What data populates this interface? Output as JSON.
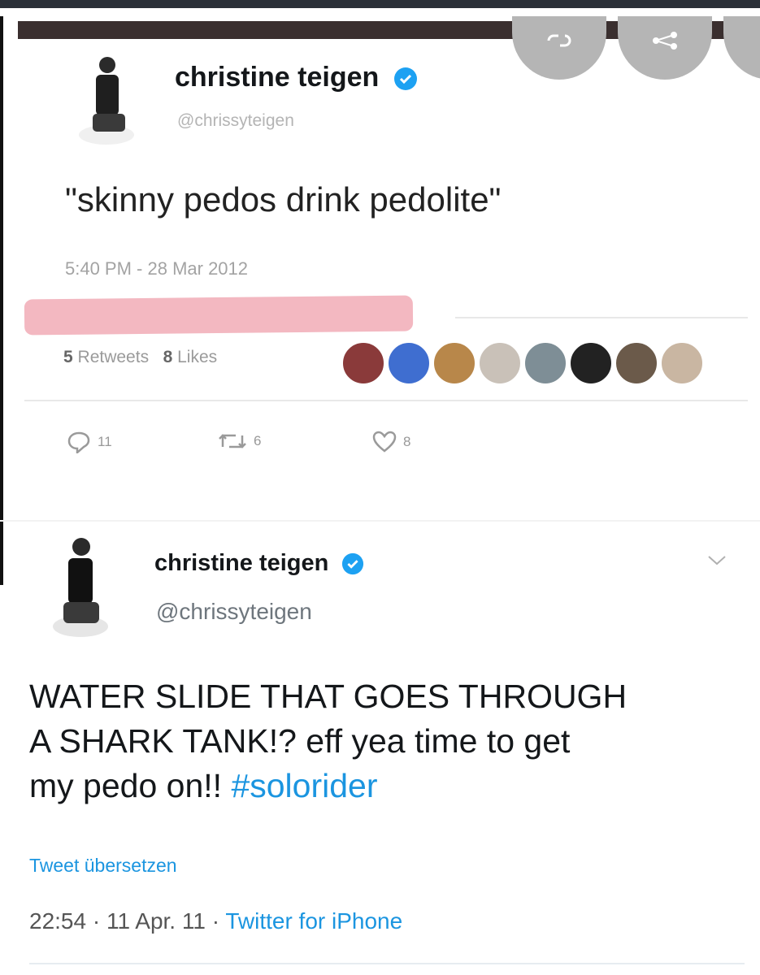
{
  "tweet1": {
    "name": "christine teigen",
    "handle": "@chrissyteigen",
    "text": "\"skinny pedos drink pedolite\"",
    "timestamp": "5:40 PM - 28 Mar 2012",
    "retweets_count": "5",
    "retweets_label": "Retweets",
    "likes_count": "8",
    "likes_label": "Likes",
    "reply_count": "11",
    "retweet_count": "6",
    "like_count": "8"
  },
  "tweet2": {
    "name": "christine teigen",
    "handle": "@chrissyteigen",
    "text_line1": "WATER SLIDE THAT GOES THROUGH",
    "text_line2": "A SHARK TANK!? eff yea time to get",
    "text_line3": "my pedo on!! ",
    "hashtag": "#solorider",
    "translate": "Tweet übersetzen",
    "time": "22:54",
    "date": "11 Apr. 11",
    "source": "Twitter for iPhone"
  },
  "colors": {
    "link": "#1b95e0",
    "verified": "#1da1f2",
    "redaction": "#f3b8c1"
  },
  "icons": [
    "verified-badge-icon",
    "reply-icon",
    "retweet-icon",
    "like-icon",
    "chevron-down-icon",
    "link-icon"
  ]
}
